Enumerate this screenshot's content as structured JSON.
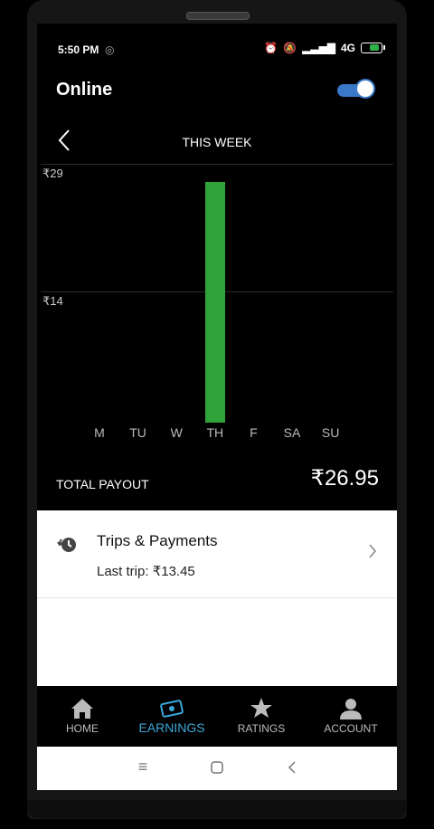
{
  "status_bar": {
    "time": "5:50 PM",
    "network": "4G",
    "battery_color": "#2fb14a"
  },
  "header": {
    "title": "Online",
    "toggle_on": true,
    "toggle_color": "#3a78c9"
  },
  "earnings": {
    "period_title": "THIS WEEK",
    "chart_data": {
      "type": "bar",
      "categories": [
        "M",
        "TU",
        "W",
        "TH",
        "F",
        "SA",
        "SU"
      ],
      "values": [
        0,
        0,
        0,
        26.95,
        0,
        0,
        0
      ],
      "y_tick_labels": [
        "₹29",
        "₹14"
      ],
      "ylim": [
        0,
        29
      ],
      "bar_color": "#2fa33a",
      "grid": true
    },
    "total_label": "TOTAL PAYOUT",
    "total_value": "₹26.95"
  },
  "card": {
    "title": "Trips & Payments",
    "subtitle": "Last trip: ₹13.45"
  },
  "bottom_nav": {
    "items": [
      {
        "label": "HOME",
        "icon": "home-icon"
      },
      {
        "label": "EARNINGS",
        "icon": "earnings-icon",
        "active": true
      },
      {
        "label": "RATINGS",
        "icon": "star-icon"
      },
      {
        "label": "ACCOUNT",
        "icon": "person-icon"
      }
    ],
    "active_color": "#3aa8d8"
  },
  "system_nav": {
    "icons": [
      "menu-icon",
      "home-square-icon",
      "back-icon"
    ]
  }
}
